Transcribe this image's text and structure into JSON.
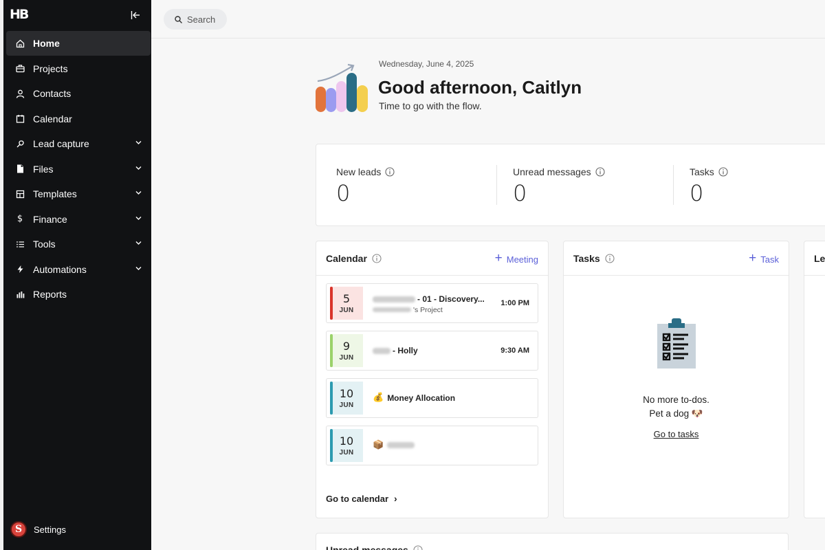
{
  "sidebar": {
    "logo": "HB",
    "items": [
      {
        "label": "Home",
        "icon": "home-icon"
      },
      {
        "label": "Projects",
        "icon": "briefcase-icon"
      },
      {
        "label": "Contacts",
        "icon": "user-icon"
      },
      {
        "label": "Calendar",
        "icon": "calendar-icon"
      },
      {
        "label": "Lead capture",
        "icon": "lead-capture-icon"
      },
      {
        "label": "Files",
        "icon": "file-icon"
      },
      {
        "label": "Templates",
        "icon": "templates-icon"
      },
      {
        "label": "Finance",
        "icon": "dollar-icon"
      },
      {
        "label": "Tools",
        "icon": "list-icon"
      },
      {
        "label": "Automations",
        "icon": "lightning-icon"
      },
      {
        "label": "Reports",
        "icon": "bar-chart-icon"
      }
    ],
    "settings": {
      "label": "Settings",
      "avatar_letter": "S"
    }
  },
  "search": {
    "label": "Search"
  },
  "greeting": {
    "date": "Wednesday, June 4, 2025",
    "title": "Good afternoon, Caitlyn",
    "subtitle": "Time to go with the flow."
  },
  "stats": [
    {
      "label": "New leads",
      "value": "0"
    },
    {
      "label": "Unread messages",
      "value": "0"
    },
    {
      "label": "Tasks",
      "value": "0"
    }
  ],
  "calendar_card": {
    "title": "Calendar",
    "action": "Meeting",
    "events": [
      {
        "day": "5",
        "month": "JUN",
        "title": "- 01 - Discovery...",
        "subtitle": "'s Project",
        "time": "1:00 PM",
        "color": "#d9342b",
        "bg": "#fbe3e2"
      },
      {
        "day": "9",
        "month": "JUN",
        "title": "- Holly",
        "time": "9:30 AM",
        "color": "#9bd26a",
        "bg": "#eef7e6"
      },
      {
        "day": "10",
        "month": "JUN",
        "emoji": "💰",
        "title": "Money Allocation",
        "color": "#2d9bb0",
        "bg": "#e3f1f4"
      },
      {
        "day": "10",
        "month": "JUN",
        "emoji": "📦",
        "title": "",
        "color": "#2d9bb0",
        "bg": "#e3f1f4"
      }
    ],
    "footer_link": "Go to calendar"
  },
  "tasks_card": {
    "title": "Tasks",
    "action": "Task",
    "empty_line1": "No more to-dos.",
    "empty_line2": "Pet a dog 🐶",
    "link": "Go to tasks"
  },
  "third_card": {
    "title": "Le"
  },
  "bottom_card": {
    "title": "Unread messages"
  }
}
